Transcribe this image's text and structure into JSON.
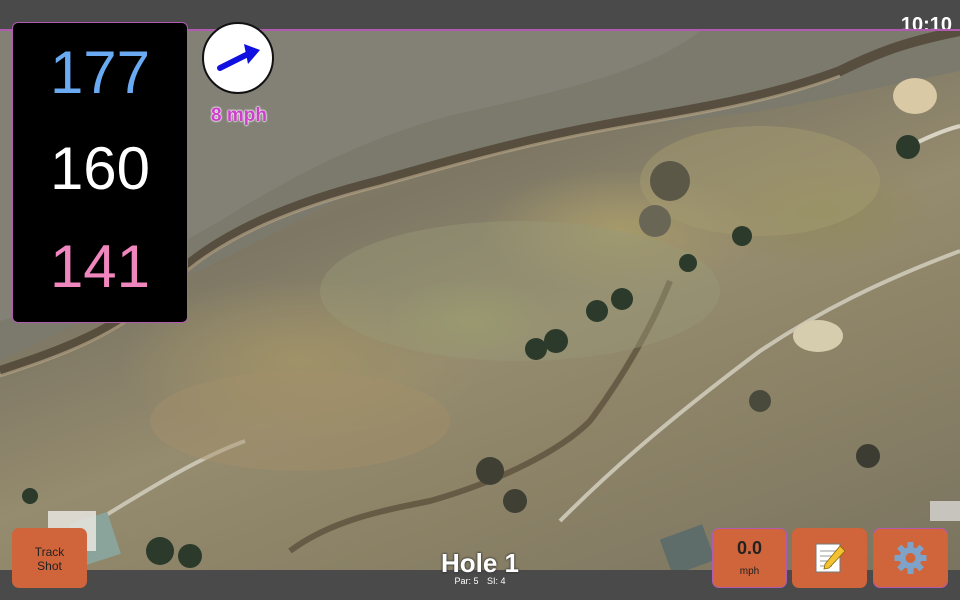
{
  "status_bar": {
    "time": "10:10"
  },
  "yardages": {
    "back": "177",
    "middle": "160",
    "front": "141"
  },
  "wind": {
    "speed": "8 mph",
    "icon": "wind-arrow-icon"
  },
  "hole": {
    "title": "Hole 1",
    "par": "Par: 5",
    "stroke_index": "SI: 4"
  },
  "buttons": {
    "track_shot_line1": "Track",
    "track_shot_line2": "Shot",
    "speed_value": "0.0",
    "speed_unit": "mph",
    "notes_icon": "notepad-icon",
    "settings_icon": "gear-icon"
  },
  "colors": {
    "back_yardage": "#6aaaf2",
    "middle_yardage": "#ffffff",
    "front_yardage": "#ef86bd",
    "button": "#d0643a",
    "accent": "#b05bb0"
  }
}
